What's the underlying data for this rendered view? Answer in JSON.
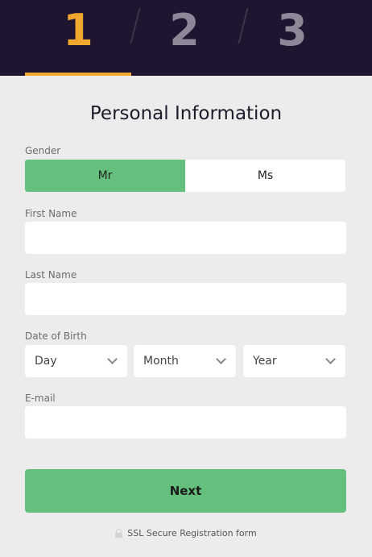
{
  "stepper": {
    "steps": [
      "1",
      "2",
      "3"
    ],
    "active_step": 1
  },
  "form": {
    "title": "Personal Information",
    "gender": {
      "label": "Gender",
      "options": [
        "Mr",
        "Ms"
      ],
      "selected": "Mr"
    },
    "first_name": {
      "label": "First Name",
      "value": ""
    },
    "last_name": {
      "label": "Last Name",
      "value": ""
    },
    "dob": {
      "label": "Date of Birth",
      "day": "Day",
      "month": "Month",
      "year": "Year"
    },
    "email": {
      "label": "E-mail",
      "value": ""
    },
    "next_label": "Next",
    "ssl_text": "SSL Secure Registration form"
  },
  "colors": {
    "header_bg": "#1f1530",
    "accent_orange": "#f0a82f",
    "inactive_step": "#8d8797",
    "accent_green": "#64c07c",
    "page_bg": "#ececec"
  },
  "icons": {
    "dropdown": "chevron-down-icon",
    "ssl": "lock-icon"
  }
}
